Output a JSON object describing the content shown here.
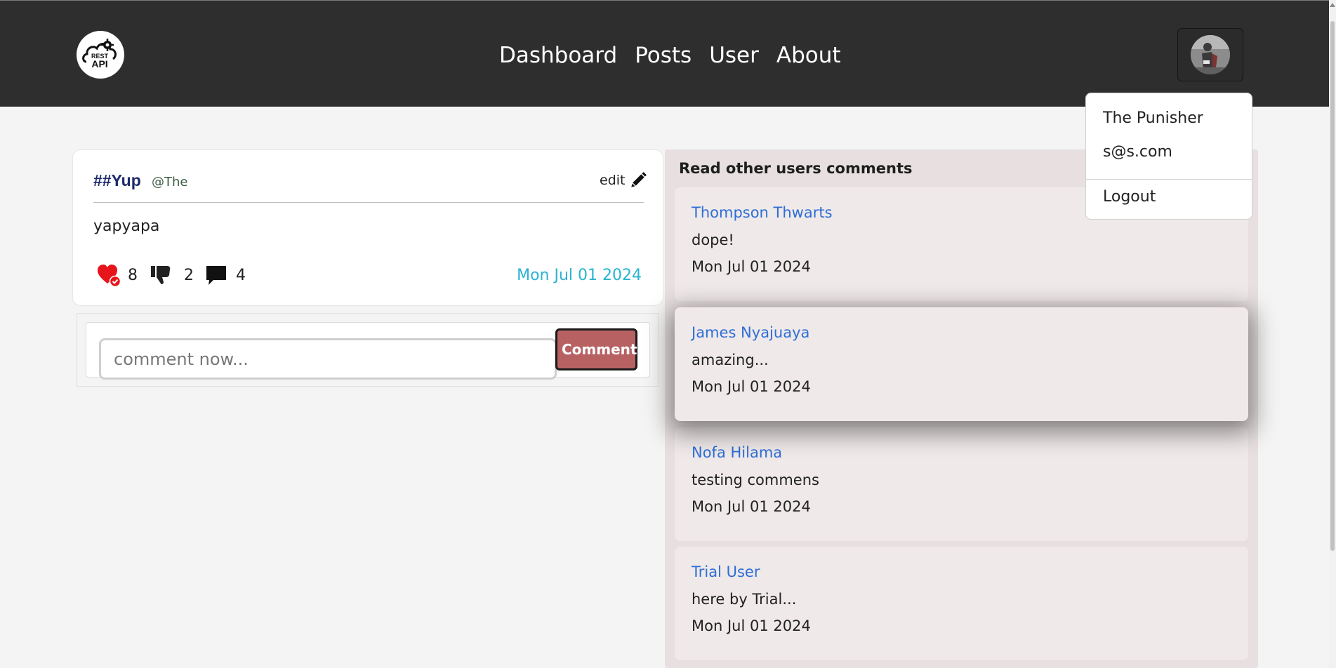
{
  "header": {
    "logo_top": "REST",
    "logo_bottom": "API",
    "nav": [
      {
        "label": "Dashboard"
      },
      {
        "label": "Posts"
      },
      {
        "label": "User"
      },
      {
        "label": "About"
      }
    ],
    "avatar_icon": "user-avatar-photo",
    "colors": {
      "background": "#2e2e2e",
      "text": "#ffffff"
    }
  },
  "user_menu": {
    "name": "The Punisher",
    "email": "s@s.com",
    "logout_label": "Logout"
  },
  "post": {
    "title": "##Yup",
    "handle": "@The",
    "edit_label": "edit",
    "body": "yapyapa",
    "likes": "8",
    "dislikes": "2",
    "comments": "4",
    "date": "Mon Jul 01 2024",
    "icons": {
      "like": "heart-check-icon",
      "dislike": "thumbs-down-icon",
      "comment": "speech-bubble-icon",
      "edit": "pencil-icon"
    }
  },
  "comment_form": {
    "placeholder": "comment now...",
    "button_label": "Comment",
    "button_color": "#b86163"
  },
  "comments_panel": {
    "heading": "Read other users comments",
    "items": [
      {
        "user": "Thompson Thwarts",
        "text": "dope!",
        "date": "Mon Jul 01 2024"
      },
      {
        "user": "James Nyajuaya",
        "text": "amazing...",
        "date": "Mon Jul 01 2024"
      },
      {
        "user": "Nofa Hilama",
        "text": "testing commens",
        "date": "Mon Jul 01 2024"
      },
      {
        "user": "Trial User",
        "text": "here by Trial...",
        "date": "Mon Jul 01 2024"
      }
    ],
    "link_color": "#2e6ed6"
  }
}
